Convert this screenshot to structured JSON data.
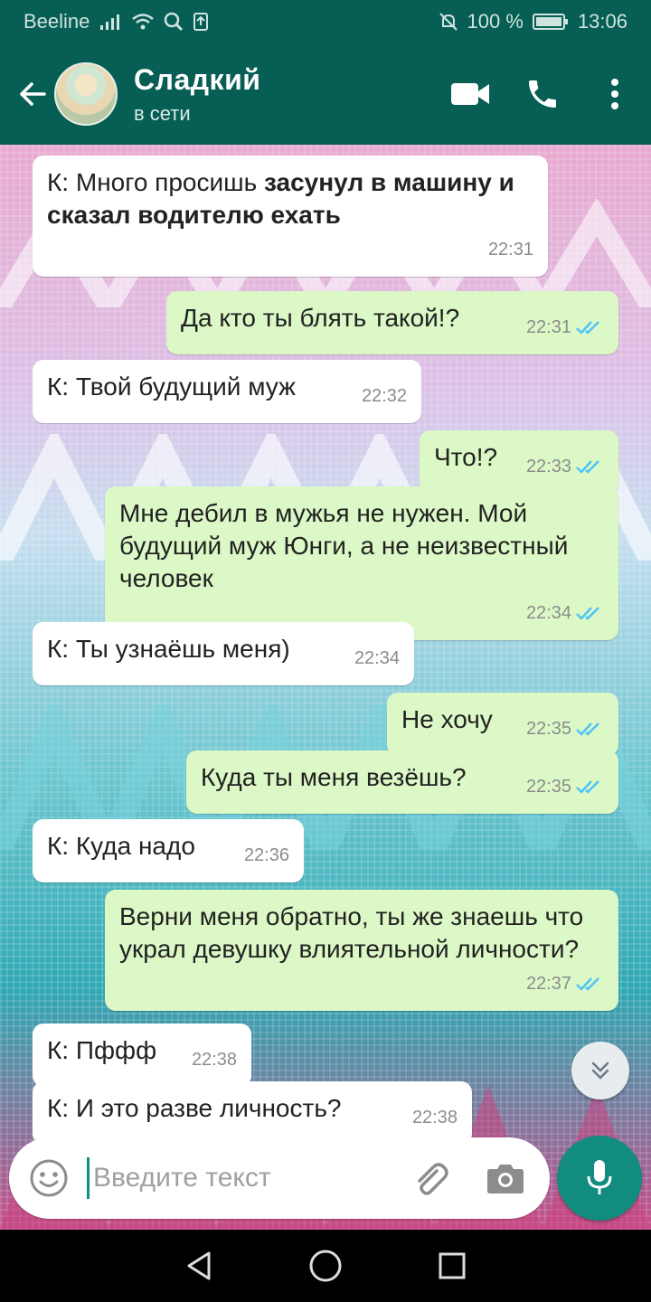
{
  "status_bar": {
    "carrier": "Beeline",
    "battery": "100 %",
    "time": "13:06"
  },
  "header": {
    "contact_name": "Сладкий",
    "contact_status": "в сети"
  },
  "messages": [
    {
      "dir": "in",
      "text": "К: Много просишь ",
      "bold": "засунул в машину и сказал водителю ехать",
      "time": "22:31"
    },
    {
      "dir": "out",
      "text": "Да кто ты блять такой!?",
      "time": "22:31"
    },
    {
      "dir": "in",
      "text": "К: Твой будущий муж",
      "time": "22:32"
    },
    {
      "dir": "out",
      "text": "Что!?",
      "time": "22:33"
    },
    {
      "dir": "out",
      "text": "Мне дебил в мужья не нужен. Мой будущий муж Юнги, а не неизвестный человек",
      "time": "22:34"
    },
    {
      "dir": "in",
      "text": "К: Ты узнаёшь меня)",
      "time": "22:34"
    },
    {
      "dir": "out",
      "text": "Не хочу",
      "time": "22:35"
    },
    {
      "dir": "out",
      "text": "Куда ты меня везёшь?",
      "time": "22:35"
    },
    {
      "dir": "in",
      "text": "К: Куда надо",
      "time": "22:36"
    },
    {
      "dir": "out",
      "text": "Верни меня обратно, ты же знаешь что украл девушку влиятельной личности?",
      "time": "22:37"
    },
    {
      "dir": "in",
      "text": "К: Пффф",
      "time": "22:38"
    },
    {
      "dir": "in",
      "text": "К: И это разве личность?",
      "time": "22:38"
    }
  ],
  "composer": {
    "placeholder": "Введите текст"
  },
  "colors": {
    "header": "#075e54",
    "accent": "#128c7e",
    "outgoing_bubble": "#dcf8c6",
    "incoming_bubble": "#ffffff",
    "read_ticks": "#4fc3f7"
  },
  "icons": {
    "back": "arrow-left-icon",
    "video": "video-camera-icon",
    "call": "phone-icon",
    "menu": "more-vert-icon",
    "emoji": "emoji-icon",
    "attach": "paperclip-icon",
    "camera": "camera-icon",
    "mic": "microphone-icon",
    "scroll": "chevron-double-down-icon"
  }
}
